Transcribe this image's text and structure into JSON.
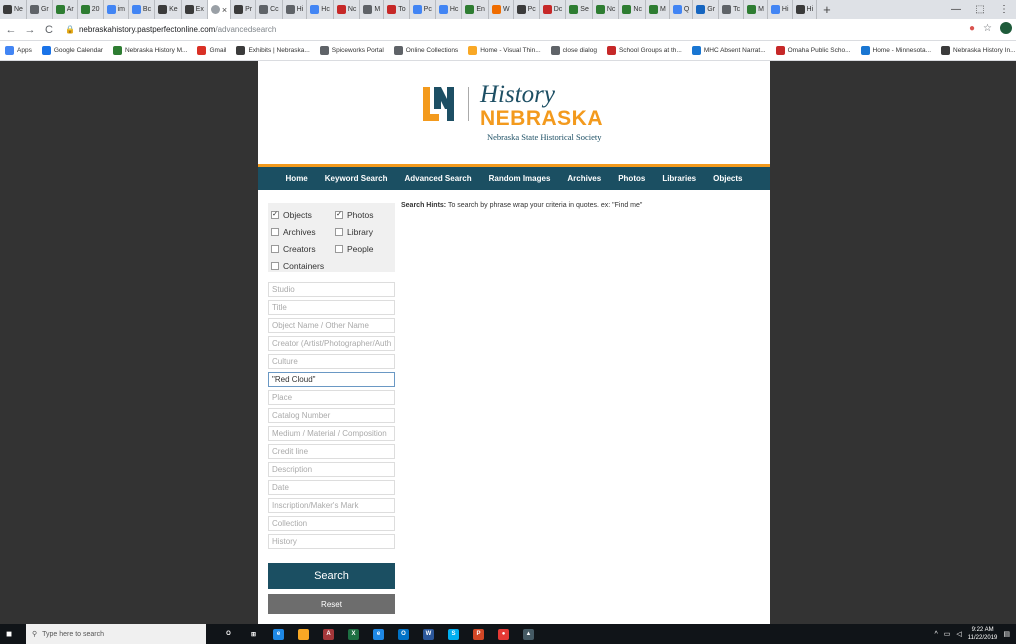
{
  "browser": {
    "tabs": [
      {
        "label": "Ne",
        "color": "#3b3b3b"
      },
      {
        "label": "Gr",
        "color": "#5f6368"
      },
      {
        "label": "Ar",
        "color": "#2e7d32"
      },
      {
        "label": "20",
        "color": "#2e7d32"
      },
      {
        "label": "im",
        "color": "#4285f4"
      },
      {
        "label": "Bc",
        "color": "#4285f4"
      },
      {
        "label": "Ke",
        "color": "#3b3b3b"
      },
      {
        "label": "Ex",
        "color": "#3b3b3b"
      },
      {
        "label": "×",
        "color": "#5f6368",
        "active": true
      },
      {
        "label": "Pr",
        "color": "#3b3b3b"
      },
      {
        "label": "Cc",
        "color": "#5f6368"
      },
      {
        "label": "Hi",
        "color": "#5f6368"
      },
      {
        "label": "Hc",
        "color": "#4285f4"
      },
      {
        "label": "Nc",
        "color": "#c62828"
      },
      {
        "label": "M",
        "color": "#5f6368"
      },
      {
        "label": "To",
        "color": "#c62828"
      },
      {
        "label": "Pc",
        "color": "#4285f4"
      },
      {
        "label": "Hc",
        "color": "#4285f4"
      },
      {
        "label": "En",
        "color": "#2e7d32"
      },
      {
        "label": "W",
        "color": "#ef6c00"
      },
      {
        "label": "Pc",
        "color": "#3b3b3b"
      },
      {
        "label": "Dc",
        "color": "#c62828"
      },
      {
        "label": "Se",
        "color": "#2e7d32"
      },
      {
        "label": "Nc",
        "color": "#2e7d32"
      },
      {
        "label": "Nc",
        "color": "#2e7d32"
      },
      {
        "label": "M",
        "color": "#2e7d32"
      },
      {
        "label": "Q",
        "color": "#4285f4"
      },
      {
        "label": "Gr",
        "color": "#1565c0"
      },
      {
        "label": "Tc",
        "color": "#5f6368"
      },
      {
        "label": "M",
        "color": "#2e7d32"
      },
      {
        "label": "Hi",
        "color": "#4285f4"
      },
      {
        "label": "Hi",
        "color": "#3b3b3b"
      }
    ],
    "new_tab": "+",
    "window_controls": [
      "—",
      "⬚",
      "⋮"
    ],
    "url_host": "nebraskahistory.pastperfectonline.com",
    "url_path": "/advancedsearch",
    "bookmarks": [
      {
        "label": "Apps",
        "color": "#4285f4"
      },
      {
        "label": "Google Calendar",
        "color": "#1a73e8"
      },
      {
        "label": "Nebraska History M...",
        "color": "#2e7d32"
      },
      {
        "label": "Gmail",
        "color": "#d93025"
      },
      {
        "label": "Exhibits | Nebraska...",
        "color": "#3b3b3b"
      },
      {
        "label": "Spiceworks Portal",
        "color": "#5f6368"
      },
      {
        "label": "Online Collections",
        "color": "#5f6368"
      },
      {
        "label": "Home - Visual Thin...",
        "color": "#f9a825"
      },
      {
        "label": "close dialog",
        "color": "#5f6368"
      },
      {
        "label": "School Groups at th...",
        "color": "#c62828"
      },
      {
        "label": "MHC Absent Narrat...",
        "color": "#1976d2"
      },
      {
        "label": "Omaha Public Scho...",
        "color": "#c62828"
      },
      {
        "label": "Home - Minnesota...",
        "color": "#1976d2"
      },
      {
        "label": "Nebraska History In...",
        "color": "#3b3b3b"
      }
    ]
  },
  "site": {
    "logo_history": "History",
    "logo_nebraska": "NEBRASKA",
    "logo_sub": "Nebraska State Historical Society",
    "nav": [
      "Home",
      "Keyword Search",
      "Advanced Search",
      "Random Images",
      "Archives",
      "Photos",
      "Libraries",
      "Objects"
    ],
    "filters": [
      {
        "label": "Objects",
        "checked": true
      },
      {
        "label": "Photos",
        "checked": true
      },
      {
        "label": "Archives",
        "checked": false
      },
      {
        "label": "Library",
        "checked": false
      },
      {
        "label": "Creators",
        "checked": false
      },
      {
        "label": "People",
        "checked": false
      },
      {
        "label": "Containers",
        "checked": false
      }
    ],
    "hints_label": "Search Hints:",
    "hints_text": " To search by phrase wrap your criteria in quotes. ex: \"Find me\"",
    "fields": [
      {
        "placeholder": "Studio",
        "value": ""
      },
      {
        "placeholder": "Title",
        "value": ""
      },
      {
        "placeholder": "Object Name / Other Name",
        "value": ""
      },
      {
        "placeholder": "Creator (Artist/Photographer/Author)",
        "value": ""
      },
      {
        "placeholder": "Culture",
        "value": ""
      },
      {
        "placeholder": "",
        "value": "\"Red Cloud\"",
        "focused": true
      },
      {
        "placeholder": "Place",
        "value": ""
      },
      {
        "placeholder": "Catalog Number",
        "value": ""
      },
      {
        "placeholder": "Medium / Material / Composition",
        "value": ""
      },
      {
        "placeholder": "Credit line",
        "value": ""
      },
      {
        "placeholder": "Description",
        "value": ""
      },
      {
        "placeholder": "Date",
        "value": ""
      },
      {
        "placeholder": "Inscription/Maker's Mark",
        "value": ""
      },
      {
        "placeholder": "Collection",
        "value": ""
      },
      {
        "placeholder": "History",
        "value": ""
      }
    ],
    "search_label": "Search",
    "reset_label": "Reset"
  },
  "taskbar": {
    "search_placeholder": "Type here to search",
    "apps": [
      {
        "label": "O",
        "color": "transparent"
      },
      {
        "label": "⊞",
        "color": "transparent"
      },
      {
        "label": "e",
        "color": "#1e88e5"
      },
      {
        "label": "",
        "color": "#f9a825"
      },
      {
        "label": "A",
        "color": "#a4373a"
      },
      {
        "label": "X",
        "color": "#1d6f42"
      },
      {
        "label": "e",
        "color": "#1e88e5"
      },
      {
        "label": "O",
        "color": "#0072c6"
      },
      {
        "label": "W",
        "color": "#2b579a"
      },
      {
        "label": "S",
        "color": "#00aff0"
      },
      {
        "label": "P",
        "color": "#d24726"
      },
      {
        "label": "●",
        "color": "#e53935"
      },
      {
        "label": "▲",
        "color": "#455a64"
      }
    ],
    "time": "9:22 AM",
    "date": "11/22/2019"
  }
}
